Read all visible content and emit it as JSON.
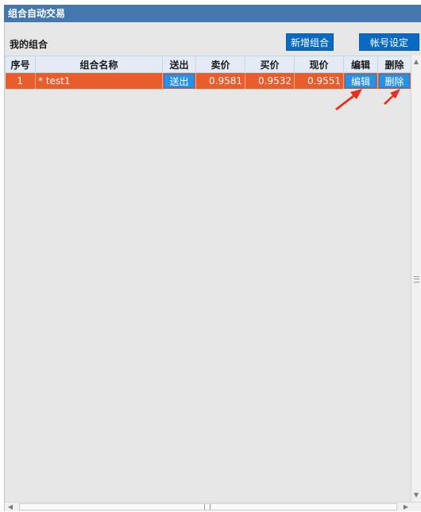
{
  "window": {
    "title": "组合自动交易"
  },
  "toolbar": {
    "section_title": "我的组合",
    "new_portfolio_label": "新增组合",
    "account_settings_label": "帐号设定"
  },
  "table": {
    "headers": [
      "序号",
      "组合名称",
      "送出",
      "卖价",
      "买价",
      "现价",
      "编辑",
      "删除"
    ],
    "rows": [
      {
        "index": "1",
        "name": "* test1",
        "send_label": "送出",
        "ask": "0.9581",
        "bid": "0.9532",
        "last": "0.9551",
        "edit_label": "编辑",
        "delete_label": "删除"
      }
    ]
  },
  "colors": {
    "titlebar": "#4477b0",
    "selected_row": "#e85d2b",
    "button": "#0a6ac0",
    "inline_button": "#2592e8",
    "annotation_arrow": "#ee2a1b"
  }
}
